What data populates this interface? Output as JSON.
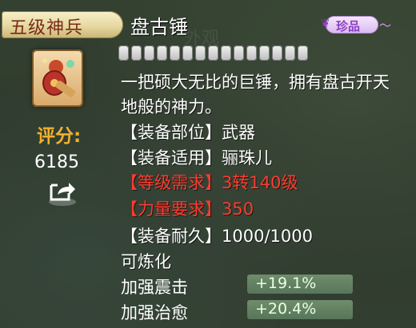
{
  "tooltip": {
    "rank_banner": "五级神兵",
    "item_name": "盘古锤",
    "quality_badge": "珍品",
    "star_slots": 15,
    "score_label": "评分:",
    "score_value": "6185",
    "description": "一把硕大无比的巨锤，拥有盘古开天地般的神力。",
    "attributes": [
      {
        "label": "【装备部位】",
        "value": "武器",
        "color": "#ffffff"
      },
      {
        "label": "【装备适用】",
        "value": "骊珠儿",
        "color": "#ffffff"
      },
      {
        "label": "【等级需求】",
        "value": "3转140级",
        "color": "#ff3b2f"
      },
      {
        "label": "【力量要求】",
        "value": "350",
        "color": "#ff3b2f"
      },
      {
        "label": "【装备耐久】",
        "value": "1000/1000",
        "color": "#ffffff"
      }
    ],
    "refine_text": "可炼化",
    "bonus_stats": [
      {
        "label": "加强震击",
        "value": "+19.1%"
      },
      {
        "label": "加强治愈",
        "value": "+20.4%"
      }
    ],
    "colors": {
      "accent_gold": "#f0b12d",
      "requirement_red": "#ff3b2f",
      "quality_purple": "#8c3fc0"
    }
  }
}
